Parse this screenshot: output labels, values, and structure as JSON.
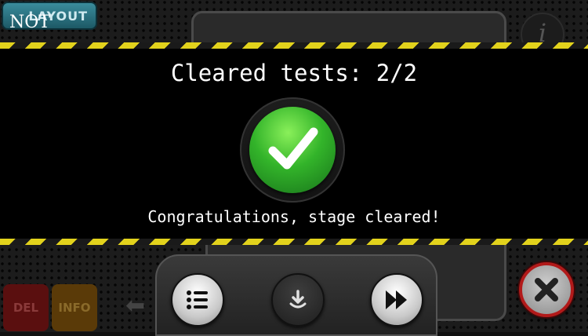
{
  "top": {
    "layout_button_label": "LAYOUT",
    "gate_label": "NOT",
    "info_icon": "info-icon"
  },
  "result": {
    "cleared_text": "Cleared tests: 2/2",
    "congrats_text": "Congratulations, stage cleared!",
    "status_icon": "checkmark-icon",
    "status_color": "#33b42a"
  },
  "bottom": {
    "del_label": "DEL",
    "info_label": "INFO",
    "menu_icon": "list-menu-icon",
    "download_icon": "download-icon",
    "next_icon": "fast-forward-icon",
    "close_icon": "close-icon"
  },
  "colors": {
    "hazard_yellow": "#e2d21c",
    "close_red": "#b21a1a"
  }
}
